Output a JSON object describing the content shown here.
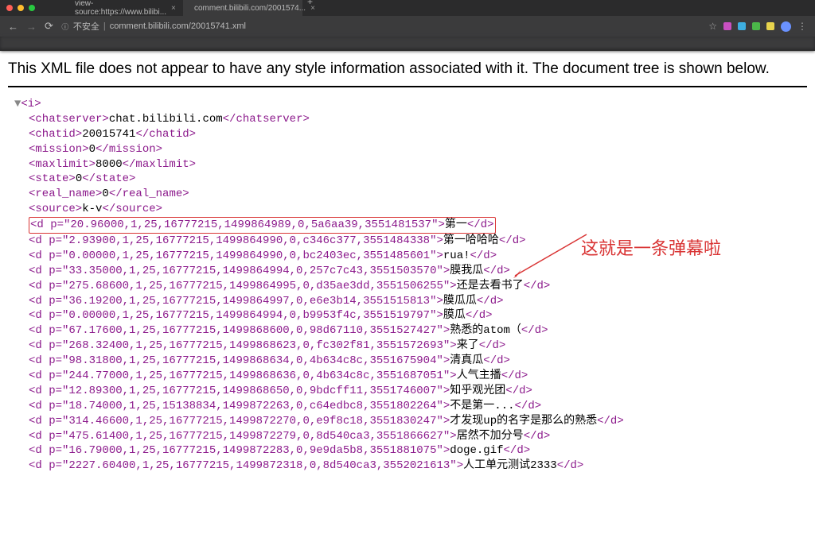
{
  "browser": {
    "tabs": [
      {
        "label": "view-source:https://www.bilibi...",
        "active": false
      },
      {
        "label": "comment.bilibili.com/2001574...",
        "active": true
      }
    ],
    "addr_insecure": "不安全",
    "addr_url": "comment.bilibili.com/20015741.xml"
  },
  "notice": "This XML file does not appear to have any style information associated with it. The document tree is shown below.",
  "xml": {
    "root_open": "<i>",
    "meta": [
      {
        "tag": "chatserver",
        "value": "chat.bilibili.com"
      },
      {
        "tag": "chatid",
        "value": "20015741"
      },
      {
        "tag": "mission",
        "value": "0"
      },
      {
        "tag": "maxlimit",
        "value": "8000"
      },
      {
        "tag": "state",
        "value": "0"
      },
      {
        "tag": "real_name",
        "value": "0"
      },
      {
        "tag": "source",
        "value": "k-v"
      }
    ],
    "d": [
      {
        "p": "20.96000,1,25,16777215,1499864989,0,5a6aa39,3551481537",
        "t": "第一",
        "highlight": true
      },
      {
        "p": "2.93900,1,25,16777215,1499864990,0,c346c377,3551484338",
        "t": "第一哈哈哈"
      },
      {
        "p": "0.00000,1,25,16777215,1499864990,0,bc2403ec,3551485601",
        "t": "rua!"
      },
      {
        "p": "33.35000,1,25,16777215,1499864994,0,257c7c43,3551503570",
        "t": "膜我瓜"
      },
      {
        "p": "275.68600,1,25,16777215,1499864995,0,d35ae3dd,3551506255",
        "t": "还是去看书了"
      },
      {
        "p": "36.19200,1,25,16777215,1499864997,0,e6e3b14,3551515813",
        "t": "膜瓜瓜"
      },
      {
        "p": "0.00000,1,25,16777215,1499864994,0,b9953f4c,3551519797",
        "t": "膜瓜"
      },
      {
        "p": "67.17600,1,25,16777215,1499868600,0,98d67110,3551527427",
        "t": "熟悉的atom（"
      },
      {
        "p": "268.32400,1,25,16777215,1499868623,0,fc302f81,3551572693",
        "t": "来了"
      },
      {
        "p": "98.31800,1,25,16777215,1499868634,0,4b634c8c,3551675904",
        "t": "清真瓜"
      },
      {
        "p": "244.77000,1,25,16777215,1499868636,0,4b634c8c,3551687051",
        "t": "人气主播"
      },
      {
        "p": "12.89300,1,25,16777215,1499868650,0,9bdcff11,3551746007",
        "t": "知乎观光团"
      },
      {
        "p": "18.74000,1,25,15138834,1499872263,0,c64edbc8,3551802264",
        "t": "不是第一..."
      },
      {
        "p": "314.46600,1,25,16777215,1499872270,0,e9f8c18,3551830247",
        "t": "才发现up的名字是那么的熟悉"
      },
      {
        "p": "475.61400,1,25,16777215,1499872279,0,8d540ca3,3551866627",
        "t": "居然不加分号"
      },
      {
        "p": "16.79000,1,25,16777215,1499872283,0,9e9da5b8,3551881075",
        "t": "doge.gif"
      },
      {
        "p": "2227.60400,1,25,16777215,1499872318,0,8d540ca3,3552021613",
        "t": "人工单元测试2333"
      }
    ]
  },
  "annotation": "这就是一条弹幕啦"
}
